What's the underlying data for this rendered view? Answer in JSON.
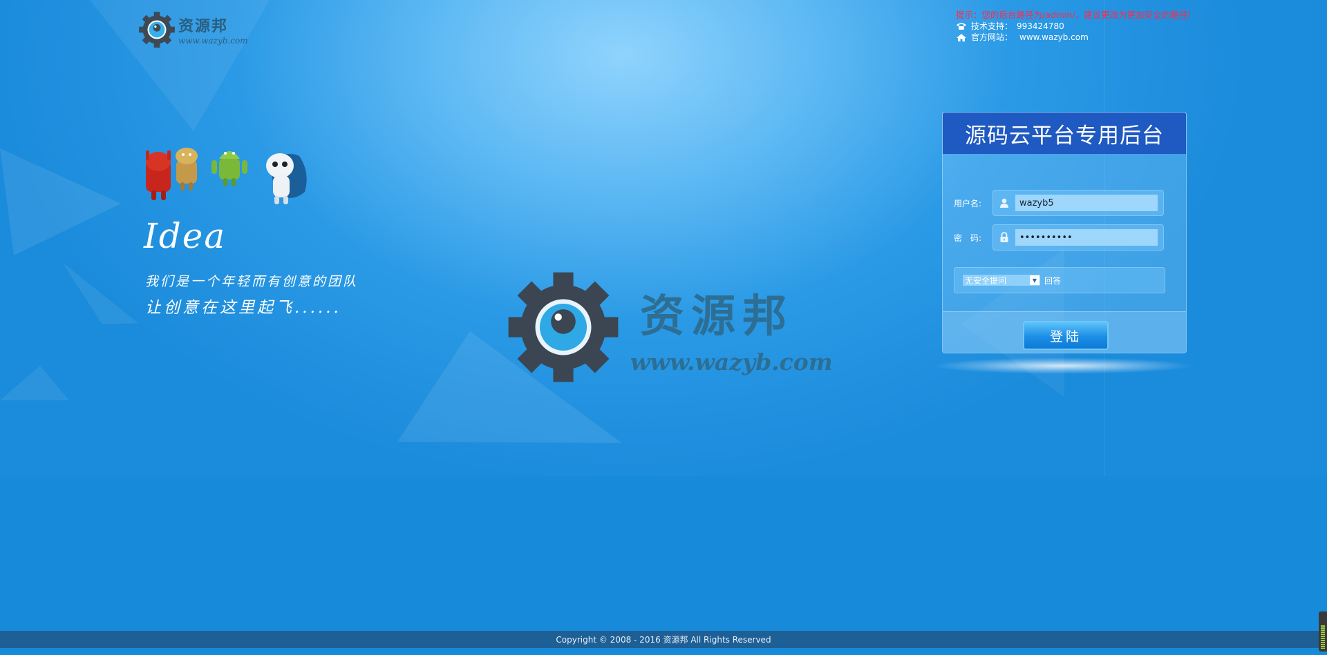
{
  "header": {
    "logo_title": "资源邦",
    "logo_url": "www.wazyb.com",
    "notice": "提示：您的后台路径为/admin/，建议更改为更加安全的路径！",
    "support_label": "技术支持：",
    "support_value": "993424780",
    "website_label": "官方网站：",
    "website_value": "www.wazyb.com"
  },
  "hero": {
    "idea": "Idea",
    "slogan_line1": "我们是一个年轻而有创意的团队",
    "slogan_line2": "让创意在这里起飞......"
  },
  "watermark": {
    "title": "资源邦",
    "url": "www.wazyb.com"
  },
  "login": {
    "title": "源码云平台专用后台",
    "username_label": "用户名:",
    "username_value": "wazyb5",
    "password_label": "密　码:",
    "password_value": "••••••••••",
    "question_select": "无安全提问",
    "answer_label": "回答",
    "submit_label": "登陆"
  },
  "footer": {
    "copyright": "Copyright © 2008 - 2016 资源邦 All Rights Reserved"
  },
  "colors": {
    "header_bar": "#1f59c2",
    "footer_bar": "#1e5f96",
    "notice_red": "#ff2a4a",
    "watermark": "#2d6e94"
  },
  "icons": [
    "gear-eye-logo-icon",
    "phone-icon",
    "home-icon",
    "user-icon",
    "lock-icon",
    "chevron-down-icon"
  ]
}
